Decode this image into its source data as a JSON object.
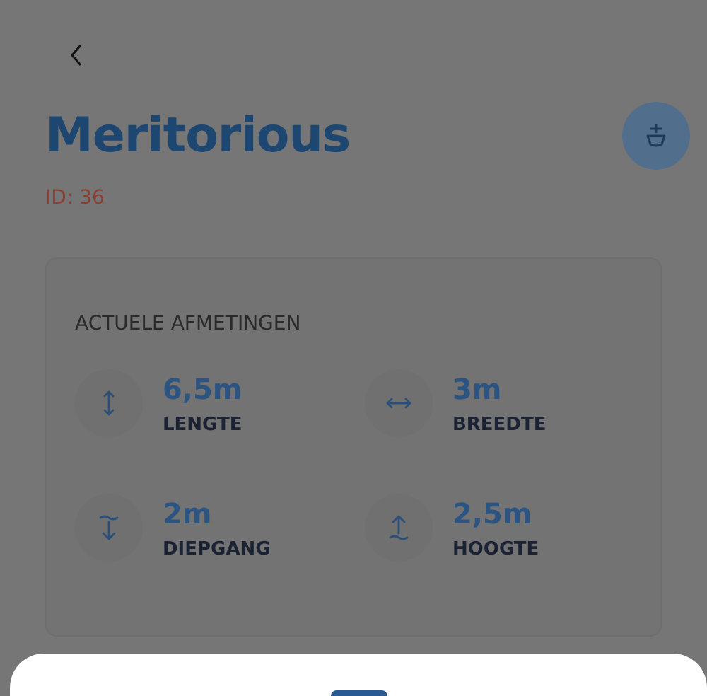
{
  "header": {
    "title": "Meritorious",
    "id_label": "ID: 36"
  },
  "dimensions": {
    "heading": "ACTUELE AFMETINGEN",
    "items": [
      {
        "kind": "length",
        "value": "6,5m",
        "label": "LENGTE"
      },
      {
        "kind": "width",
        "value": "3m",
        "label": "BREEDTE"
      },
      {
        "kind": "draft",
        "value": "2m",
        "label": "DIEPGANG"
      },
      {
        "kind": "height",
        "value": "2,5m",
        "label": "HOOGTE"
      }
    ]
  }
}
